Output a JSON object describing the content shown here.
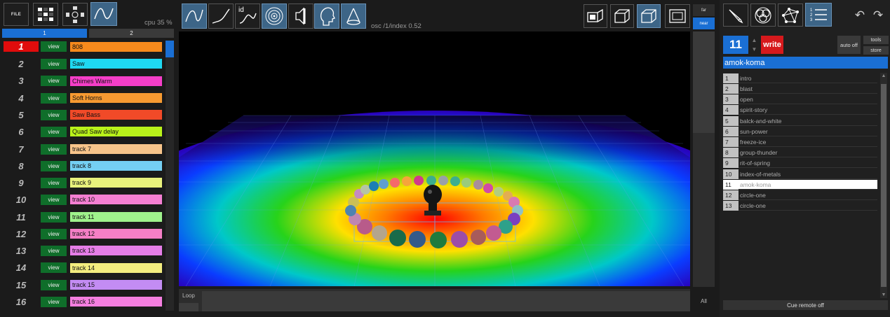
{
  "toolbar": {
    "file_label": "FILE",
    "cpu": "cpu 35 %",
    "osc": "osc /1/index 0.52",
    "id_label": "id"
  },
  "banks": [
    {
      "label": "1",
      "active": true
    },
    {
      "label": "2",
      "active": false
    }
  ],
  "tracks": [
    {
      "num": "1",
      "view": "view",
      "name": "808",
      "color": "#f78a1c",
      "selected": true
    },
    {
      "num": "2",
      "view": "view",
      "name": "Saw",
      "color": "#1fd9f2"
    },
    {
      "num": "3",
      "view": "view",
      "name": "Chimes Warm",
      "color": "#f53ec8"
    },
    {
      "num": "4",
      "view": "view",
      "name": "Soft Horns",
      "color": "#f79a31"
    },
    {
      "num": "5",
      "view": "view",
      "name": "Saw Bass",
      "color": "#f14a28"
    },
    {
      "num": "6",
      "view": "view",
      "name": "Quad Saw delay",
      "color": "#b9f21a"
    },
    {
      "num": "7",
      "view": "view",
      "name": "track 7",
      "color": "#f8c48a"
    },
    {
      "num": "8",
      "view": "view",
      "name": "track 8",
      "color": "#74cff3"
    },
    {
      "num": "9",
      "view": "view",
      "name": "track 9",
      "color": "#e9f27c"
    },
    {
      "num": "10",
      "view": "view",
      "name": "track 10",
      "color": "#f57fd2"
    },
    {
      "num": "11",
      "view": "view",
      "name": "track 11",
      "color": "#9ff28c"
    },
    {
      "num": "12",
      "view": "view",
      "name": "track 12",
      "color": "#f57fc6"
    },
    {
      "num": "13",
      "view": "view",
      "name": "track 13",
      "color": "#e67ee8"
    },
    {
      "num": "14",
      "view": "view",
      "name": "track 14",
      "color": "#f3ed7f"
    },
    {
      "num": "15",
      "view": "view",
      "name": "track 15",
      "color": "#c38cf3"
    },
    {
      "num": "16",
      "view": "view",
      "name": "track 16",
      "color": "#f57fe0"
    }
  ],
  "viewport": {
    "far_label": "far",
    "near_label": "near",
    "loop_label": "Loop",
    "all_label": "All"
  },
  "cues": {
    "current": "11",
    "write_label": "write",
    "auto_off_label": "auto off",
    "tools_label": "tools",
    "store_label": "store",
    "project": "amok-koma",
    "items": [
      {
        "idx": "1",
        "name": "intro"
      },
      {
        "idx": "2",
        "name": "blast"
      },
      {
        "idx": "3",
        "name": "open"
      },
      {
        "idx": "4",
        "name": "spirit-story"
      },
      {
        "idx": "5",
        "name": "balck-and-white"
      },
      {
        "idx": "6",
        "name": "sun-power"
      },
      {
        "idx": "7",
        "name": "freeze-ice"
      },
      {
        "idx": "8",
        "name": "group-thunder"
      },
      {
        "idx": "9",
        "name": "rit-of-spring"
      },
      {
        "idx": "10",
        "name": "index-of-metals"
      },
      {
        "idx": "11",
        "name": "amok-koma",
        "selected": true
      },
      {
        "idx": "12",
        "name": "circle-one"
      },
      {
        "idx": "13",
        "name": "circle-one"
      }
    ],
    "remote_label": "Cue remote off"
  }
}
